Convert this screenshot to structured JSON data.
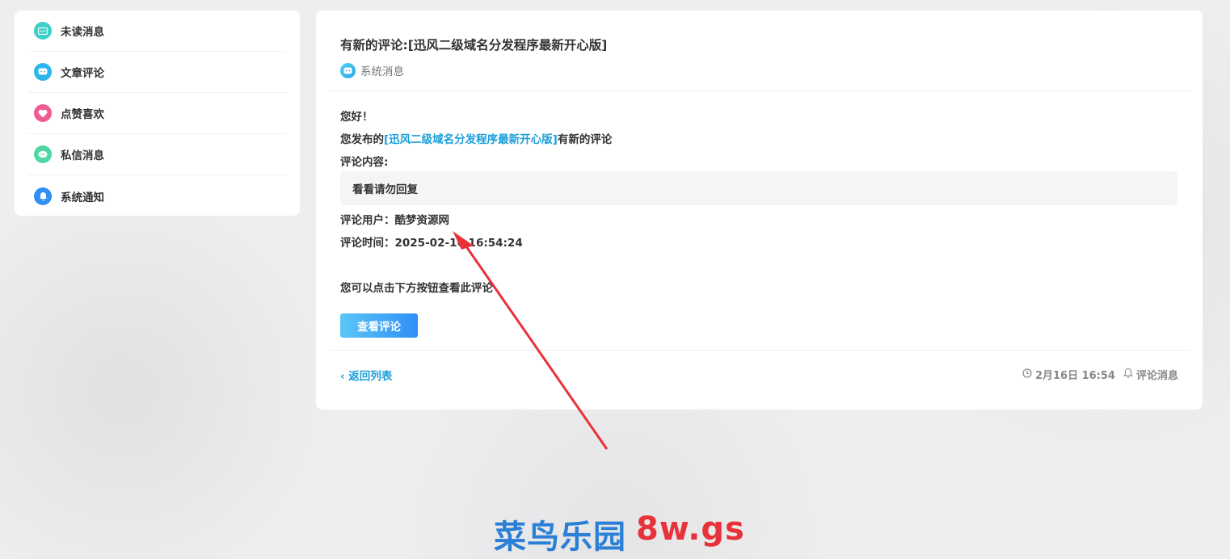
{
  "sidebar": {
    "items": [
      {
        "label": "未读消息",
        "icon": "unread-message-icon",
        "color": "#3dd0c9"
      },
      {
        "label": "文章评论",
        "icon": "comment-icon",
        "color": "#2cb6ea"
      },
      {
        "label": "点赞喜欢",
        "icon": "heart-icon",
        "color": "#f05b93"
      },
      {
        "label": "私信消息",
        "icon": "chat-icon",
        "color": "#4fd6a3"
      },
      {
        "label": "系统通知",
        "icon": "bell-icon",
        "color": "#2f8ff5"
      }
    ]
  },
  "message": {
    "title": "有新的评论:[迅风二级域名分发程序最新开心版]",
    "tag": "系统消息",
    "greeting": "您好！",
    "published_prefix": "您发布的",
    "post_link": "[迅风二级域名分发程序最新开心版]",
    "published_suffix": "有新的评论",
    "comment_content_label": "评论内容:",
    "comment_text": "看看请勿回复",
    "comment_user": "评论用户：酷梦资源网",
    "comment_time": "评论时间：2025-02-16 16:54:24",
    "hint": "您可以点击下方按钮查看此评论",
    "view_button": "查看评论",
    "back_link": "‹ 返回列表",
    "date": "2月16日 16:54",
    "category": "评论消息"
  },
  "watermark": {
    "part1": "菜鸟乐园",
    "part2": "8w.gs"
  },
  "colors": {
    "accent": "#1a9fd9",
    "button_start": "#5cc6f7",
    "button_end": "#2f8ff5",
    "arrow": "#e8323a"
  }
}
